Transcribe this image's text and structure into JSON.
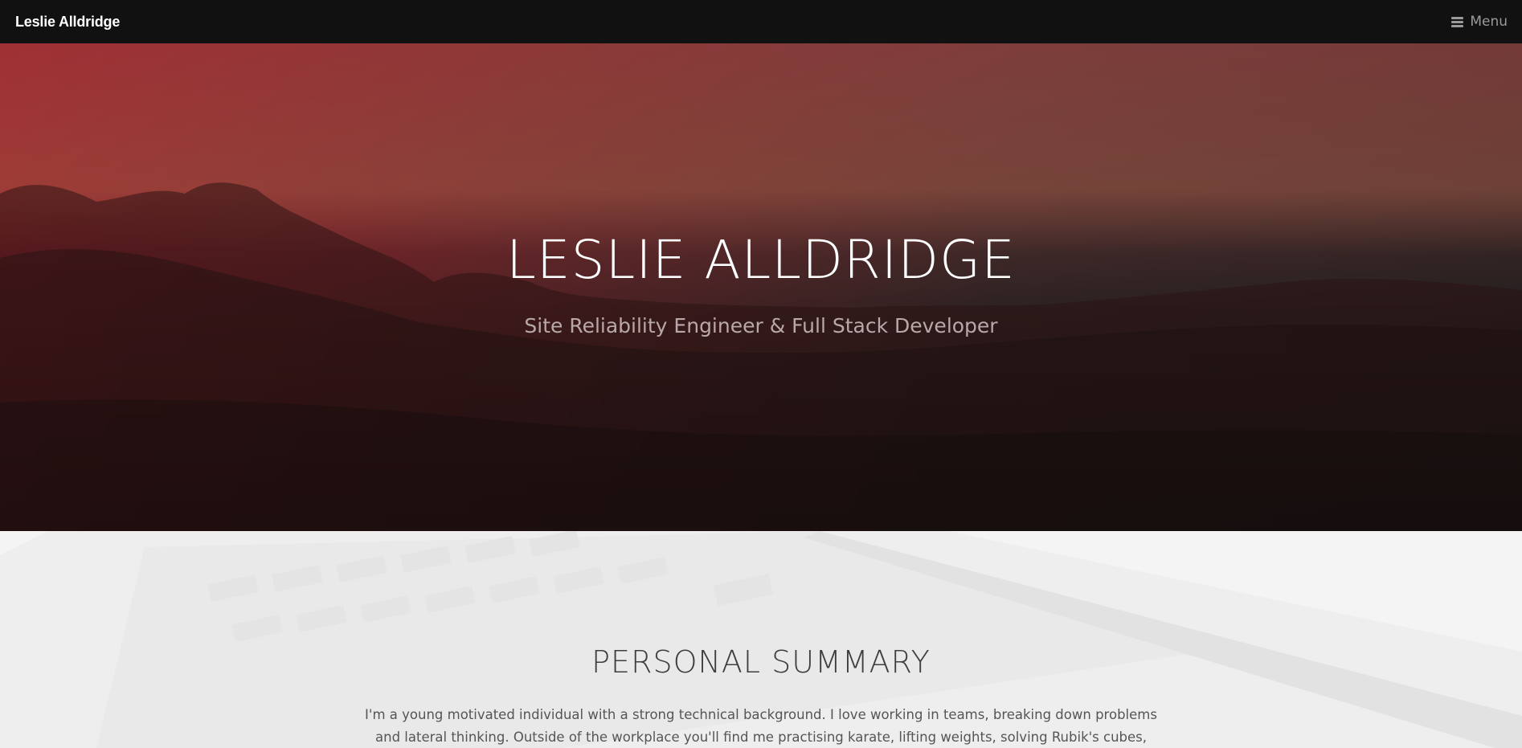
{
  "navbar": {
    "brand": "Leslie Alldridge",
    "menu_label": "Menu",
    "menu_icon": "hamburger-icon"
  },
  "hero": {
    "title": "LESLIE ALLDRIDGE",
    "subtitle": "Site Reliability Engineer & Full Stack Developer"
  },
  "summary": {
    "heading": "PERSONAL SUMMARY",
    "text": "I'm a young motivated individual with a strong technical background. I love working in teams, breaking down problems and lateral thinking. Outside of the workplace you'll find me practising karate, lifting weights, solving Rubik's cubes, coding"
  },
  "colors": {
    "navbar_bg": "#111111",
    "hero_accent": "#8e2a32",
    "summary_bg": "#f6f6f6"
  }
}
